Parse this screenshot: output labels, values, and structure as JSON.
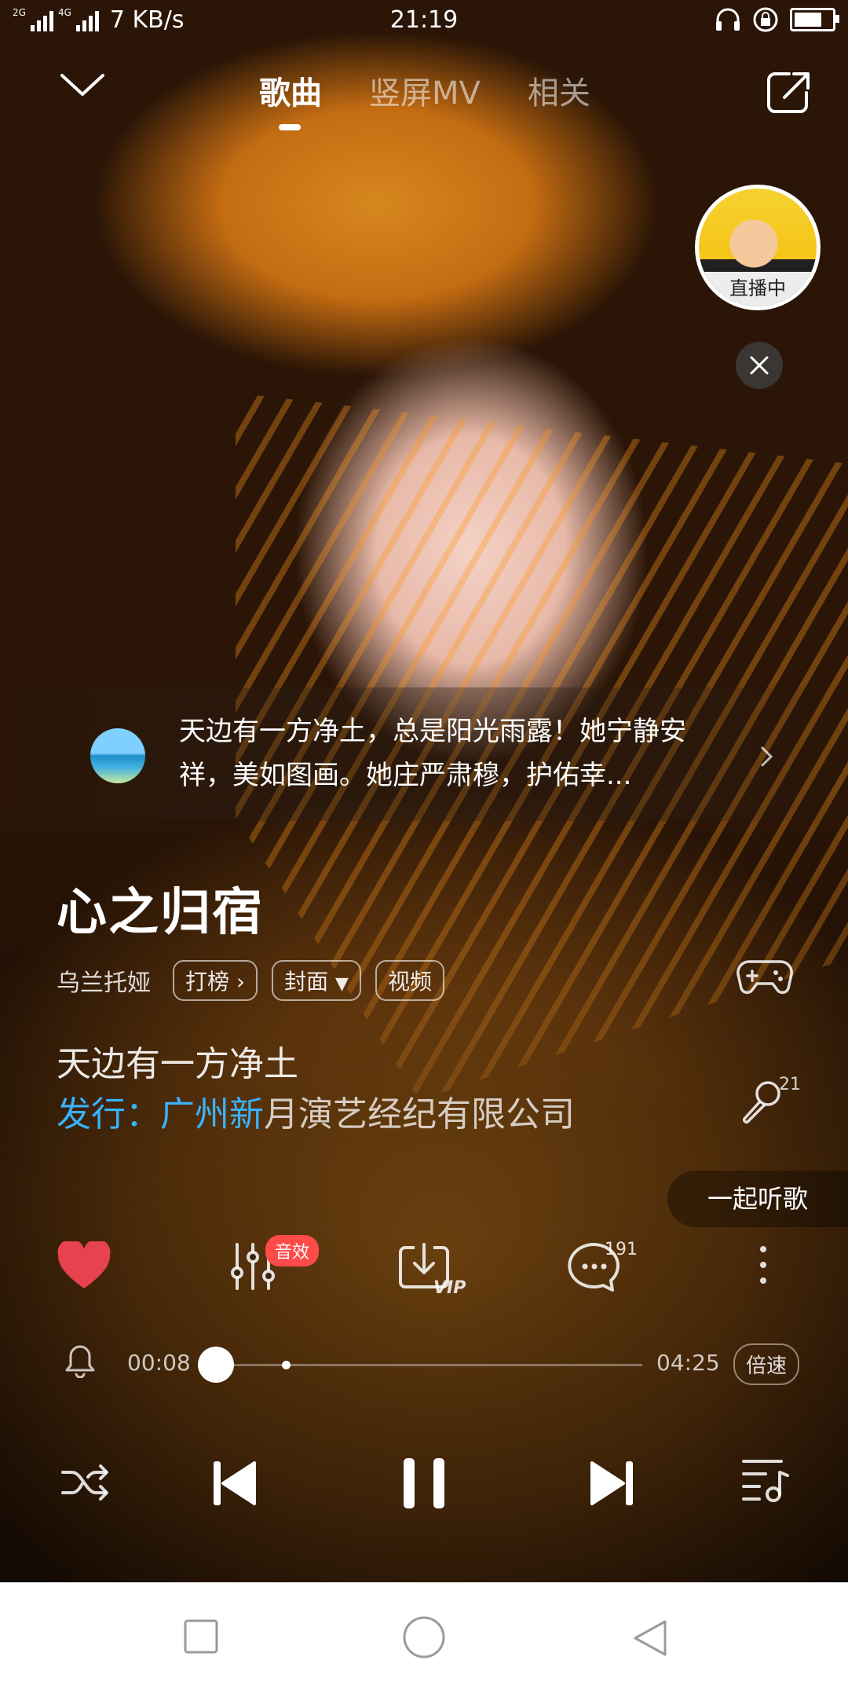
{
  "status_bar": {
    "network_label_1": "2G",
    "network_label_2": "4G",
    "speed": "7 KB/s",
    "time": "21:19",
    "battery_percent": 85
  },
  "nav": {
    "tabs": [
      "歌曲",
      "竖屏MV",
      "相关"
    ],
    "active_tab": 0
  },
  "live": {
    "label": "直播中"
  },
  "comment": {
    "text": "天边有一方净土，总是阳光雨露！她宁静安祥，美如图画。她庄严肃穆，护佑幸..."
  },
  "song": {
    "title": "心之归宿",
    "artist": "乌兰托娅",
    "chips": {
      "rank": "打榜",
      "cover": "封面",
      "video": "视频"
    },
    "lyric_current": "天边有一方净土",
    "lyric_next_highlight": "发行：广州新",
    "lyric_next_rest": "月演艺经纪有限公司",
    "mic_count": "21",
    "listen_together": "一起听歌"
  },
  "actions": {
    "effect_badge": "音效",
    "comment_count": "191"
  },
  "player": {
    "current_time": "00:08",
    "total_time": "04:25",
    "speed_label": "倍速",
    "progress_fraction": 0.0302,
    "buffer_fraction": 0.19
  },
  "colors": {
    "accent_blue": "#38b3ff",
    "like_red": "#e8424f",
    "badge_red": "#ff4a4a"
  }
}
